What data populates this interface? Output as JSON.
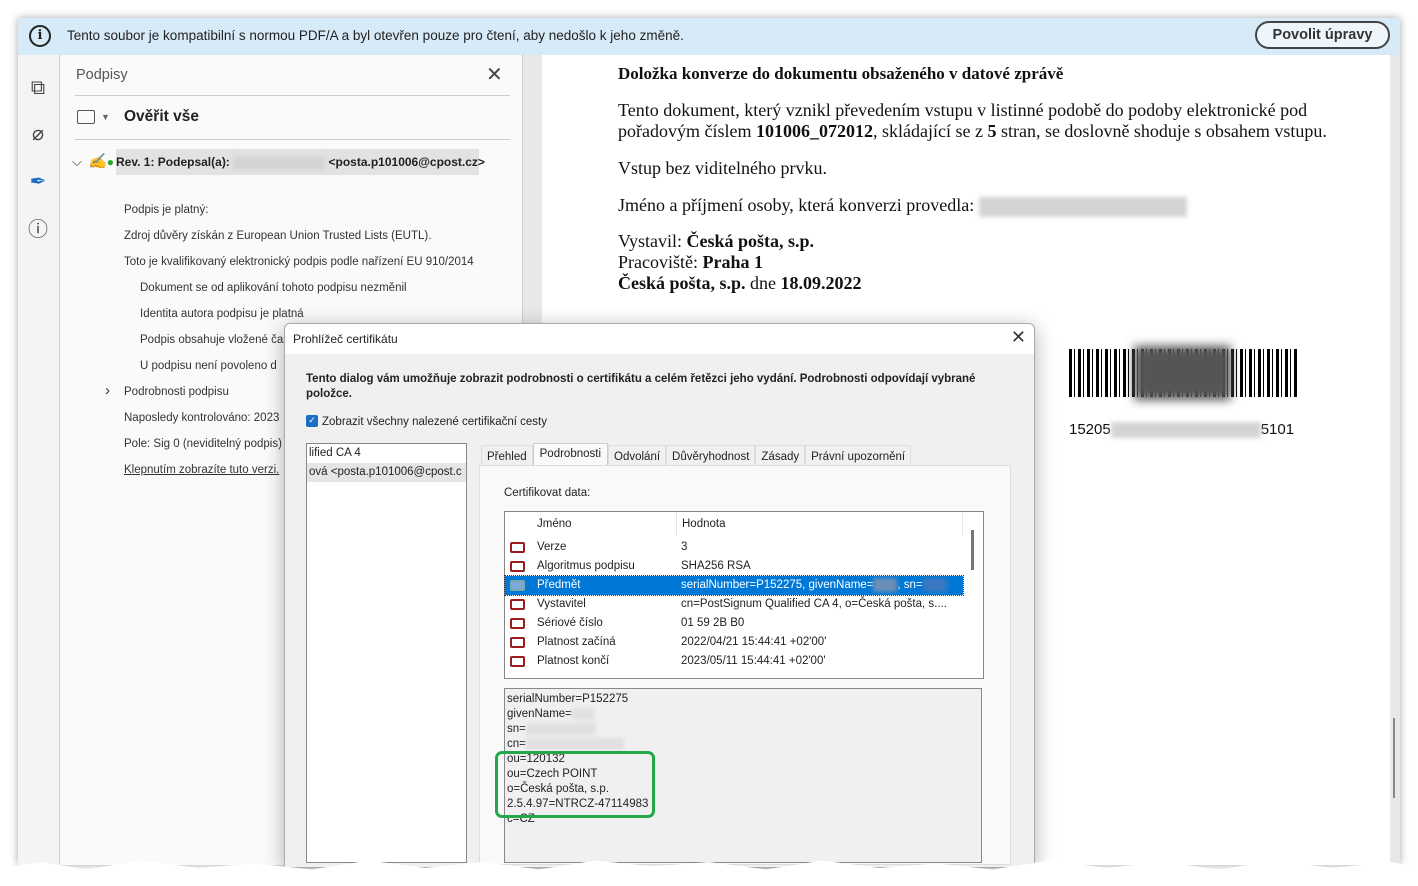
{
  "infobar": {
    "message": "Tento soubor je kompatibilní s normou PDF/A a byl otevřen pouze pro čtení, aby nedošlo k jeho změně.",
    "enable_button": "Povolit úpravy"
  },
  "panel": {
    "title": "Podpisy",
    "verify_all": "Ověřit vše",
    "revision": {
      "label": "Rev. 1: Podepsal(a):",
      "email": "<posta.p101006@cpost.cz>"
    },
    "items": [
      "Podpis je platný:",
      "Zdroj důvěry získán z European Union Trusted Lists (EUTL).",
      "Toto je kvalifikovaný elektronický podpis podle nařízení EU 910/2014"
    ],
    "subitems": [
      "Dokument se od aplikování tohoto podpisu nezměnil",
      "Identita autora podpisu je platná",
      "Podpis obsahuje vložené časové razítko",
      "U podpisu není povoleno d"
    ],
    "details": "Podrobnosti podpisu",
    "last_checked": "Naposledy kontrolováno: 2023",
    "field": "Pole: Sig 0 (neviditelný podpis)",
    "view_link": "Klepnutím zobrazíte tuto verzi."
  },
  "document": {
    "heading": "Doložka konverze do dokumentu obsaženého v datové zprávě",
    "p1a": "Tento dokument, který vznikl převedením vstupu v listinné podobě do podoby elektronické pod",
    "p1b": "pořadovým číslem ",
    "p1_num": "101006_072012",
    "p1c": ", skládající se z ",
    "p1_pages": "5",
    "p1d": " stran, se doslovně shoduje s obsahem vstupu.",
    "p2": "Vstup bez viditelného prvku.",
    "p3": "Jméno a příjmení osoby, která konverzi provedla:",
    "issued_label": "Vystavil: ",
    "issued_value": "Česká pošta, s.p.",
    "workplace_label": "Pracoviště: ",
    "workplace_value": "Praha 1",
    "sign_org": "Česká pošta, s.p.",
    "sign_mid": " dne ",
    "sign_date": "18.09.2022",
    "barcode_prefix": "15205",
    "barcode_suffix": "5101"
  },
  "dialog": {
    "title": "Prohlížeč certifikátu",
    "description": "Tento dialog vám umožňuje zobrazit podrobnosti o certifikátu a celém řetězci jeho vydání. Podrobnosti odpovídají vybrané položce.",
    "show_all_paths": "Zobrazit všechny nalezené certifikační cesty",
    "show_all_checked": true,
    "chain": [
      "lified CA 4",
      "ová <posta.p101006@cpost.c"
    ],
    "tabs": [
      "Přehled",
      "Podrobnosti",
      "Odvolání",
      "Důvěryhodnost",
      "Zásady",
      "Právní upozornění"
    ],
    "active_tab": "Podrobnosti",
    "cert_data_label": "Certifikovat data:",
    "columns": [
      "Jméno",
      "Hodnota"
    ],
    "rows": [
      {
        "name": "Verze",
        "value": "3"
      },
      {
        "name": "Algoritmus podpisu",
        "value": "SHA256 RSA"
      },
      {
        "name": "Předmět",
        "value": "serialNumber=P152275, givenName=",
        "value2": ", sn=",
        "selected": true
      },
      {
        "name": "Vystavitel",
        "value": "cn=PostSignum Qualified CA 4, o=Česká pošta, s...."
      },
      {
        "name": "Sériové číslo",
        "value": "01 59 2B B0"
      },
      {
        "name": "Platnost začíná",
        "value": "2022/04/21 15:44:41 +02'00'"
      },
      {
        "name": "Platnost končí",
        "value": "2023/05/11 15:44:41 +02'00'"
      }
    ],
    "detail_lines": [
      "serialNumber=P152275",
      "givenName=",
      "sn=",
      "cn=",
      "ou=120132",
      "ou=Czech POINT",
      "o=Česká pošta, s.p.",
      "2.5.4.97=NTRCZ-47114983",
      "c=CZ"
    ],
    "highlight_color": "#22a848",
    "selection_color": "#0078d7"
  }
}
